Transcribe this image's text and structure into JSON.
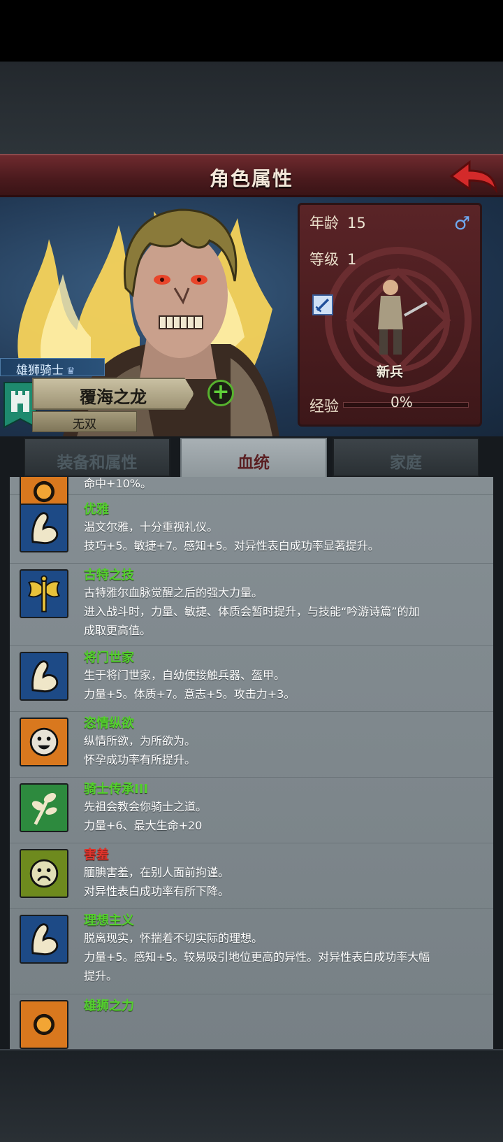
{
  "header": {
    "title": "角色属性"
  },
  "character": {
    "house_title": "雄狮骑士",
    "name": "覆海之龙",
    "epithet": "无双"
  },
  "stats": {
    "age_label": "年龄",
    "age": "15",
    "level_label": "等级",
    "level": "1",
    "gender": "male",
    "rank": "新兵",
    "exp_label": "经验",
    "exp_value": "0%",
    "exp_fraction": 0
  },
  "tabs": [
    {
      "label": "装备和属性",
      "active": false
    },
    {
      "label": "血统",
      "active": true
    },
    {
      "label": "家庭",
      "active": false
    }
  ],
  "traits": [
    {
      "name": "",
      "lines": [
        "命中+10%。"
      ],
      "icon": "sun-icon",
      "color": "#d9781e"
    },
    {
      "name": "优雅",
      "lines": [
        "温文尔雅，十分重视礼仪。",
        "技巧+5。敏捷+7。感知+5。对异性表白成功率显著提升。"
      ],
      "icon": "flexed-arm-icon",
      "color": "#1d4a86"
    },
    {
      "name": "古特之技",
      "lines": [
        "古特雅尔血脉觉醒之后的强大力量。",
        "进入战斗时，力量、敏捷、体质会暂时提升，与技能“吟游诗篇”的加",
        "成取更高值。"
      ],
      "icon": "golden-axe-icon",
      "color": "#1d4a86"
    },
    {
      "name": "将门世家",
      "lines": [
        "生于将门世家，自幼便接触兵器、盔甲。",
        "力量+5。体质+7。意志+5。攻击力+3。"
      ],
      "icon": "flexed-arm-icon",
      "color": "#1d4a86"
    },
    {
      "name": "恣情纵欲",
      "lines": [
        "纵情所欲，为所欲为。",
        "怀孕成功率有所提升。"
      ],
      "icon": "smiley-face-icon",
      "color": "#d9781e"
    },
    {
      "name": "骑士传承III",
      "lines": [
        "先祖会教会你骑士之道。",
        "力量+6、最大生命+20"
      ],
      "icon": "sprout-icon",
      "color": "#2d8a3e"
    },
    {
      "name": "害羞",
      "lines": [
        "腼腆害羞，在别人面前拘谨。",
        "对异性表白成功率有所下降。"
      ],
      "icon": "sad-face-icon",
      "color": "#6e8a1e",
      "negative": true
    },
    {
      "name": "理想主义",
      "lines": [
        "脱离现实，怀揣着不切实际的理想。",
        "力量+5。感知+5。较易吸引地位更高的异性。对异性表白成功率大幅",
        "提升。"
      ],
      "icon": "flexed-arm-icon",
      "color": "#1d4a86"
    },
    {
      "name": "雄狮之力",
      "lines": [],
      "icon": "sun-icon",
      "color": "#d9781e"
    }
  ]
}
